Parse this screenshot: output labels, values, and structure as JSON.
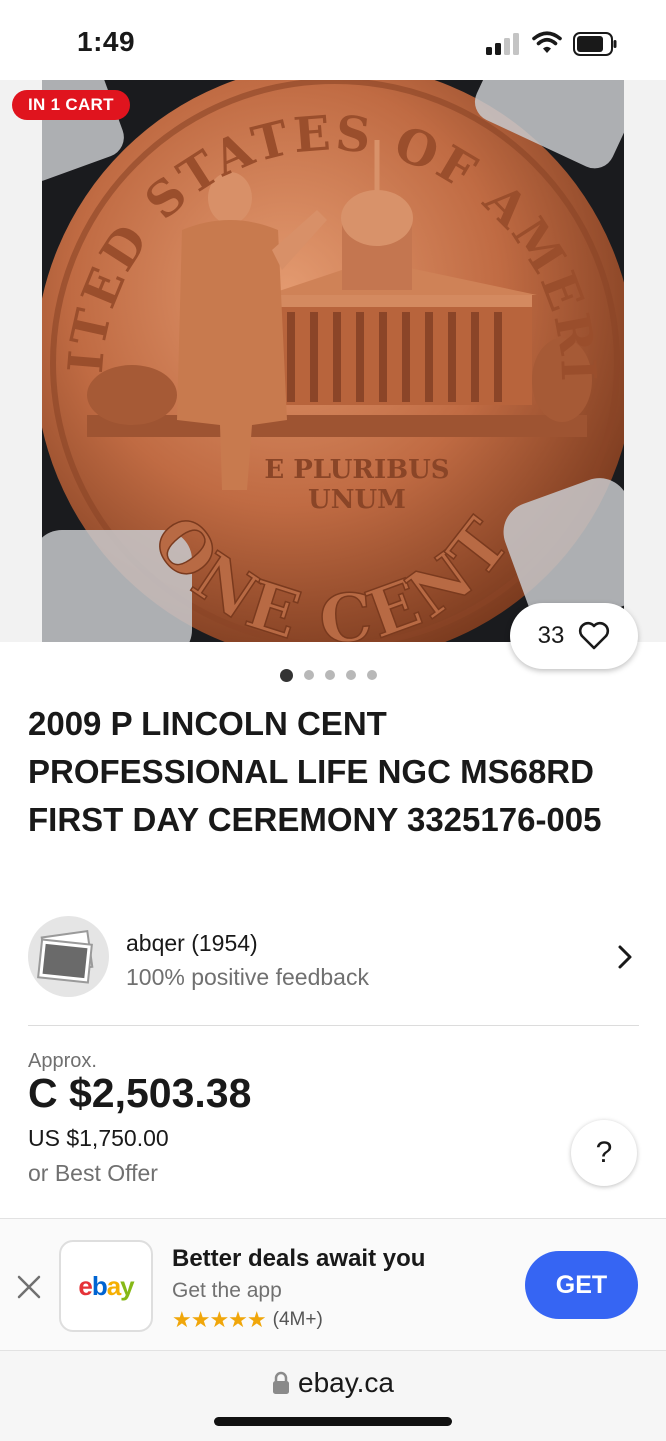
{
  "status_bar": {
    "time": "1:49"
  },
  "listing": {
    "cart_badge": "IN 1 CART",
    "watch_count": "33",
    "image_count": 5,
    "active_image": 1,
    "title": "2009 P LINCOLN CENT PROFESSIONAL LIFE NGC MS68RD FIRST DAY CEREMONY 3325176-005",
    "coin_inscriptions": [
      "UNITED STATES OF AMERICA",
      "E PLURIBUS UNUM",
      "ONE CENT"
    ]
  },
  "seller": {
    "name": "abqer (1954)",
    "feedback": "100% positive feedback"
  },
  "price": {
    "approx_label": "Approx.",
    "converted": "C $2,503.38",
    "original": "US $1,750.00",
    "offer_text": "or Best Offer",
    "help_label": "?"
  },
  "app_banner": {
    "title": "Better deals await you",
    "subtitle": "Get the app",
    "stars": "★★★★★",
    "rating_count": "(4M+)",
    "get_label": "GET",
    "logo_text": "ebay"
  },
  "browser": {
    "url": "ebay.ca"
  },
  "colors": {
    "accent": "#3665f3",
    "badge": "#e0141e",
    "star": "#f0a60a"
  }
}
